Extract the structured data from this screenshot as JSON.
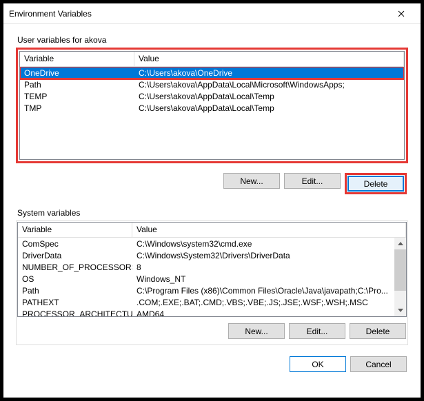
{
  "window": {
    "title": "Environment Variables"
  },
  "user_section": {
    "label": "User variables for akova",
    "columns": {
      "var": "Variable",
      "val": "Value"
    },
    "rows": [
      {
        "var": "OneDrive",
        "val": "C:\\Users\\akova\\OneDrive",
        "selected": true
      },
      {
        "var": "Path",
        "val": "C:\\Users\\akova\\AppData\\Local\\Microsoft\\WindowsApps;"
      },
      {
        "var": "TEMP",
        "val": "C:\\Users\\akova\\AppData\\Local\\Temp"
      },
      {
        "var": "TMP",
        "val": "C:\\Users\\akova\\AppData\\Local\\Temp"
      }
    ],
    "buttons": {
      "new": "New...",
      "edit": "Edit...",
      "delete": "Delete"
    }
  },
  "system_section": {
    "label": "System variables",
    "columns": {
      "var": "Variable",
      "val": "Value"
    },
    "rows": [
      {
        "var": "ComSpec",
        "val": "C:\\Windows\\system32\\cmd.exe"
      },
      {
        "var": "DriverData",
        "val": "C:\\Windows\\System32\\Drivers\\DriverData"
      },
      {
        "var": "NUMBER_OF_PROCESSORS",
        "val": "8"
      },
      {
        "var": "OS",
        "val": "Windows_NT"
      },
      {
        "var": "Path",
        "val": "C:\\Program Files (x86)\\Common Files\\Oracle\\Java\\javapath;C:\\Pro..."
      },
      {
        "var": "PATHEXT",
        "val": ".COM;.EXE;.BAT;.CMD;.VBS;.VBE;.JS;.JSE;.WSF;.WSH;.MSC"
      },
      {
        "var": "PROCESSOR_ARCHITECTURE",
        "val": "AMD64"
      }
    ],
    "buttons": {
      "new": "New...",
      "edit": "Edit...",
      "delete": "Delete"
    }
  },
  "dialog_buttons": {
    "ok": "OK",
    "cancel": "Cancel"
  }
}
